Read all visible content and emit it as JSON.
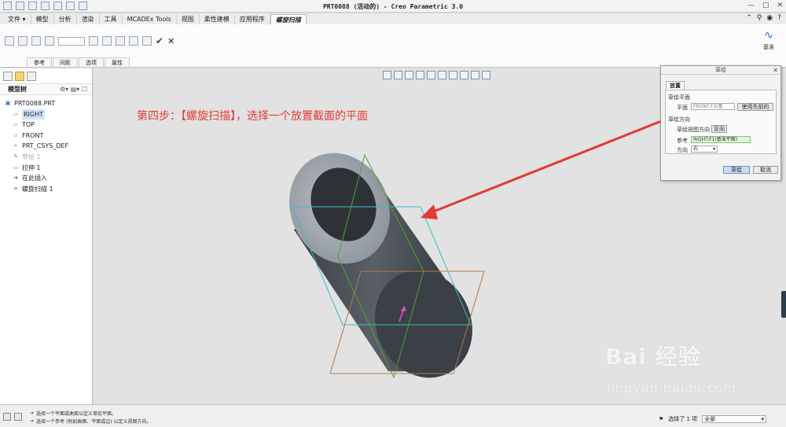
{
  "window": {
    "title": "PRT0088 (活动的) - Creo Parametric 3.0"
  },
  "tabs": [
    {
      "label": "文件 ▾",
      "active": false
    },
    {
      "label": "模型",
      "active": false
    },
    {
      "label": "分析",
      "active": false
    },
    {
      "label": "渲染",
      "active": false
    },
    {
      "label": "工具",
      "active": false
    },
    {
      "label": "MCADEx Tools",
      "active": false
    },
    {
      "label": "视图",
      "active": false
    },
    {
      "label": "柔性建模",
      "active": false
    },
    {
      "label": "应用程序",
      "active": false
    },
    {
      "label": "螺旋扫描",
      "active": true
    }
  ],
  "ribbon": {
    "subtabs": [
      "参考",
      "间距",
      "选项",
      "属性"
    ],
    "datum_label": "基准"
  },
  "model_tree": {
    "header": "模型树",
    "items": [
      {
        "label": "PRT0088.PRT",
        "icon": "part-icon",
        "indent": false,
        "highlight": false,
        "dim": false
      },
      {
        "label": "RIGHT",
        "icon": "datum-plane-icon",
        "indent": true,
        "highlight": true,
        "dim": false
      },
      {
        "label": "TOP",
        "icon": "datum-plane-icon",
        "indent": true,
        "highlight": false,
        "dim": false
      },
      {
        "label": "FRONT",
        "icon": "datum-plane-icon",
        "indent": true,
        "highlight": false,
        "dim": false
      },
      {
        "label": "PRT_CSYS_DEF",
        "icon": "csys-icon",
        "indent": true,
        "highlight": false,
        "dim": false
      },
      {
        "label": "草绘 1",
        "icon": "sketch-icon",
        "indent": true,
        "highlight": false,
        "dim": true
      },
      {
        "label": "拉伸 1",
        "icon": "extrude-icon",
        "indent": true,
        "highlight": false,
        "dim": false
      },
      {
        "label": "在此插入",
        "icon": "insert-here-icon",
        "indent": true,
        "highlight": false,
        "dim": false
      },
      {
        "label": "螺旋扫描 1",
        "icon": "helical-sweep-icon",
        "indent": true,
        "highlight": false,
        "dim": false
      }
    ]
  },
  "annotation": {
    "text": "第四步：【螺旋扫描】，选择一个放置截面的平面"
  },
  "sketch_dialog": {
    "title": "草绘",
    "tab": "放置",
    "plane_section": "草绘平面",
    "plane_label": "平面",
    "plane_value": "FRONT:F3(基",
    "use_prev_button": "使用先前的",
    "orient_section": "草绘方向",
    "view_dir_label": "草绘视图方向",
    "flip_button": "反向",
    "ref_label": "参考",
    "ref_value": "RIGHT:F1(基准平面)",
    "dir_label": "方向",
    "dir_value": "右",
    "ok_button": "草绘",
    "cancel_button": "取消"
  },
  "status": {
    "messages": [
      "选择一个平面或曲面以定义草绘平面。",
      "选择一个参考 (例如曲面、平面或边) 以定义视图方向。"
    ],
    "selected_text": "选择了 1 项",
    "filter_value": "全部"
  },
  "watermark": {
    "main": "Bai 经验",
    "url": "jingyan.baidu.com"
  },
  "colors": {
    "annotation": "#e53b36",
    "arrow": "#e23a35",
    "cylinder": "#4a4f57",
    "active_tab_border": "#b8b8b8"
  }
}
